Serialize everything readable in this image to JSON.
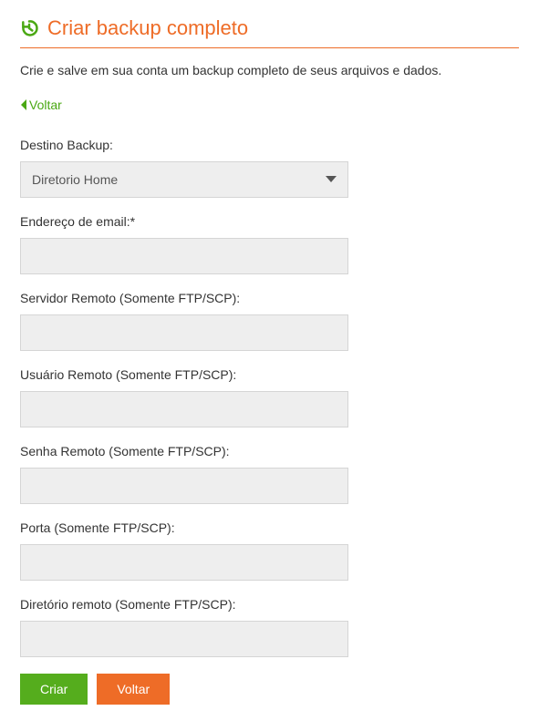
{
  "header": {
    "title": "Criar backup completo"
  },
  "description": "Crie e salve em sua conta um backup completo de seus arquivos e dados.",
  "back_link": {
    "label": "Voltar"
  },
  "form": {
    "destination": {
      "label": "Destino Backup:",
      "selected": "Diretorio Home"
    },
    "email": {
      "label": "Endereço de email:*",
      "value": ""
    },
    "remote_server": {
      "label": "Servidor Remoto (Somente FTP/SCP):",
      "value": ""
    },
    "remote_user": {
      "label": "Usuário Remoto (Somente FTP/SCP):",
      "value": ""
    },
    "remote_password": {
      "label": "Senha Remoto (Somente FTP/SCP):",
      "value": ""
    },
    "port": {
      "label": "Porta (Somente FTP/SCP):",
      "value": ""
    },
    "remote_dir": {
      "label": "Diretório remoto (Somente FTP/SCP):",
      "value": ""
    }
  },
  "buttons": {
    "create": "Criar",
    "back": "Voltar"
  }
}
